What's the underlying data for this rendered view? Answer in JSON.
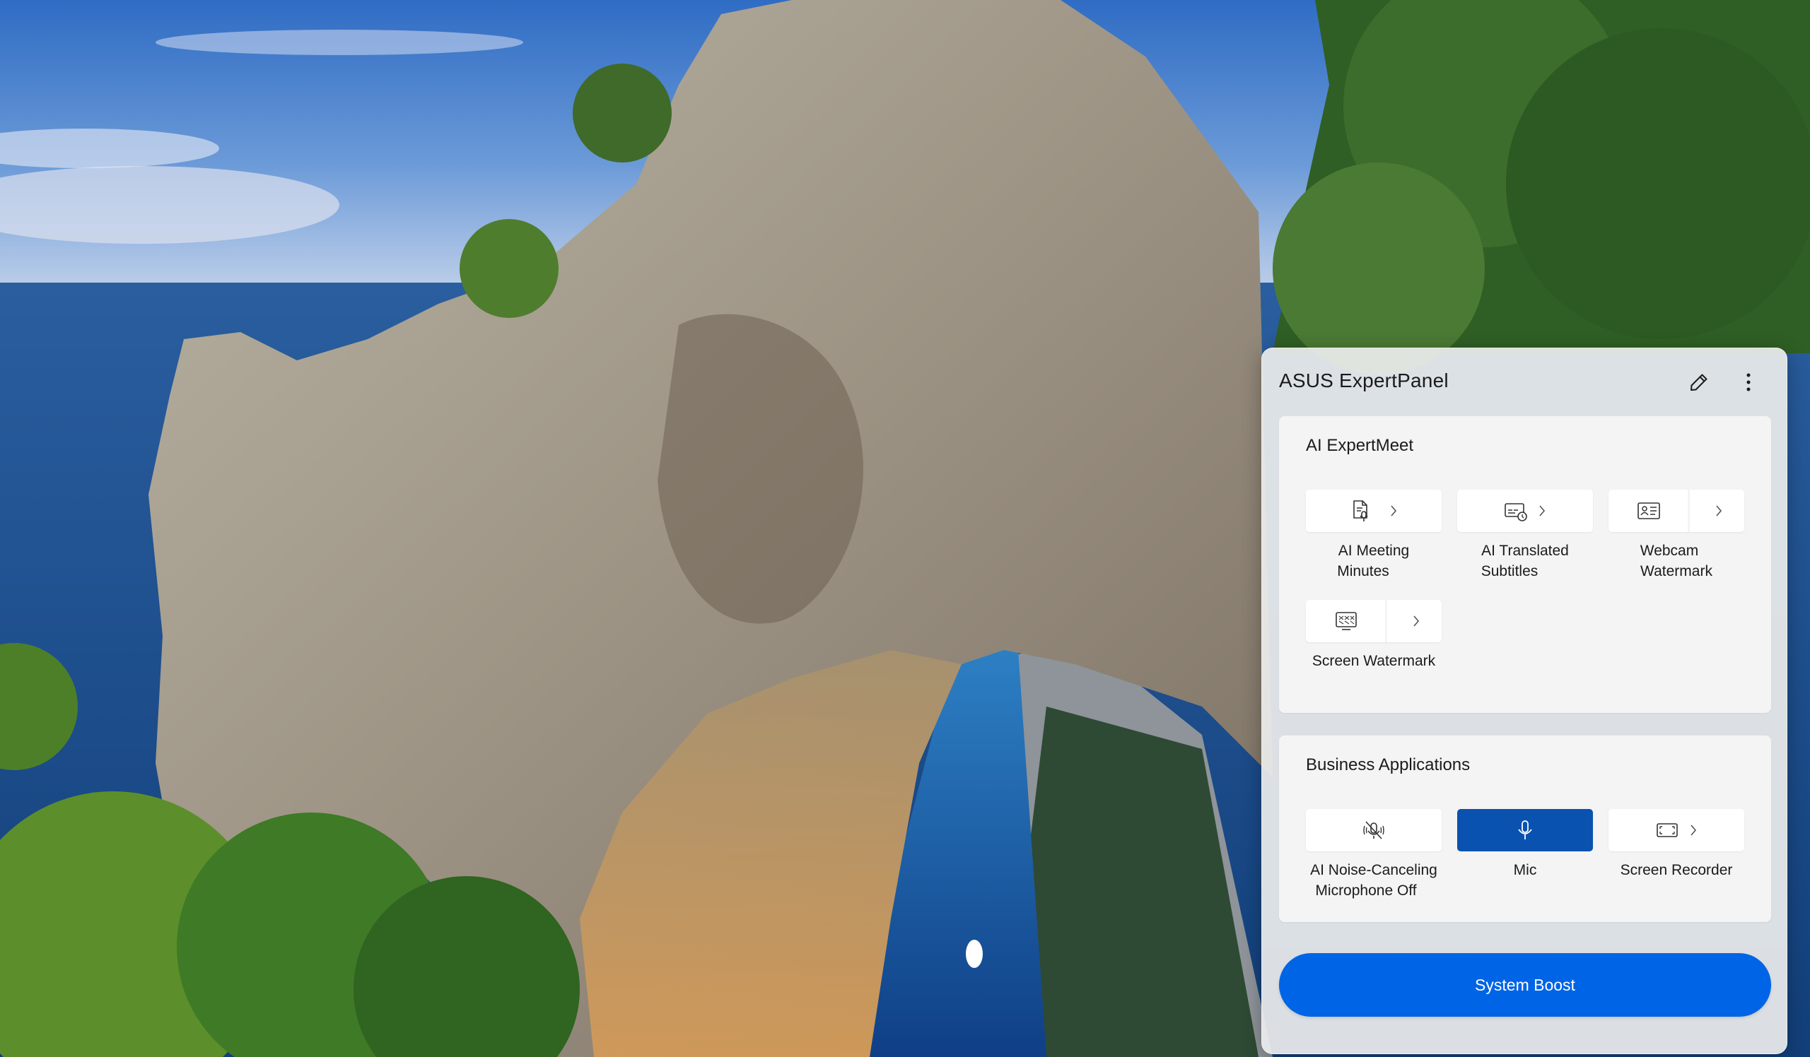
{
  "panel": {
    "title": "ASUS ExpertPanel",
    "edit_icon": "pencil-icon",
    "more_icon": "more-vertical-icon"
  },
  "expertmeet": {
    "title": "AI ExpertMeet",
    "tiles": [
      {
        "label_line1": "AI Meeting",
        "label_line2": "Minutes",
        "icon": "meeting-minutes-icon"
      },
      {
        "label_line1": "AI Translated",
        "label_line2": "Subtitles",
        "icon": "translated-subtitles-icon"
      },
      {
        "label_line1": "Webcam",
        "label_line2": "Watermark",
        "icon": "webcam-watermark-icon"
      },
      {
        "label_line1": "Screen Watermark",
        "label_line2": "",
        "icon": "screen-watermark-icon"
      }
    ]
  },
  "business": {
    "title": "Business Applications",
    "tiles": [
      {
        "label_line1": "AI Noise-Canceling",
        "label_line2": "Microphone Off",
        "icon": "noise-canceling-mic-off-icon"
      },
      {
        "label_line1": "Mic",
        "label_line2": "",
        "icon": "microphone-icon",
        "active": true
      },
      {
        "label_line1": "Screen Recorder",
        "label_line2": "",
        "icon": "screen-recorder-icon"
      }
    ]
  },
  "boost": {
    "label": "System Boost"
  },
  "colors": {
    "accent": "#0064e6",
    "active_tile": "#0a52b0"
  }
}
